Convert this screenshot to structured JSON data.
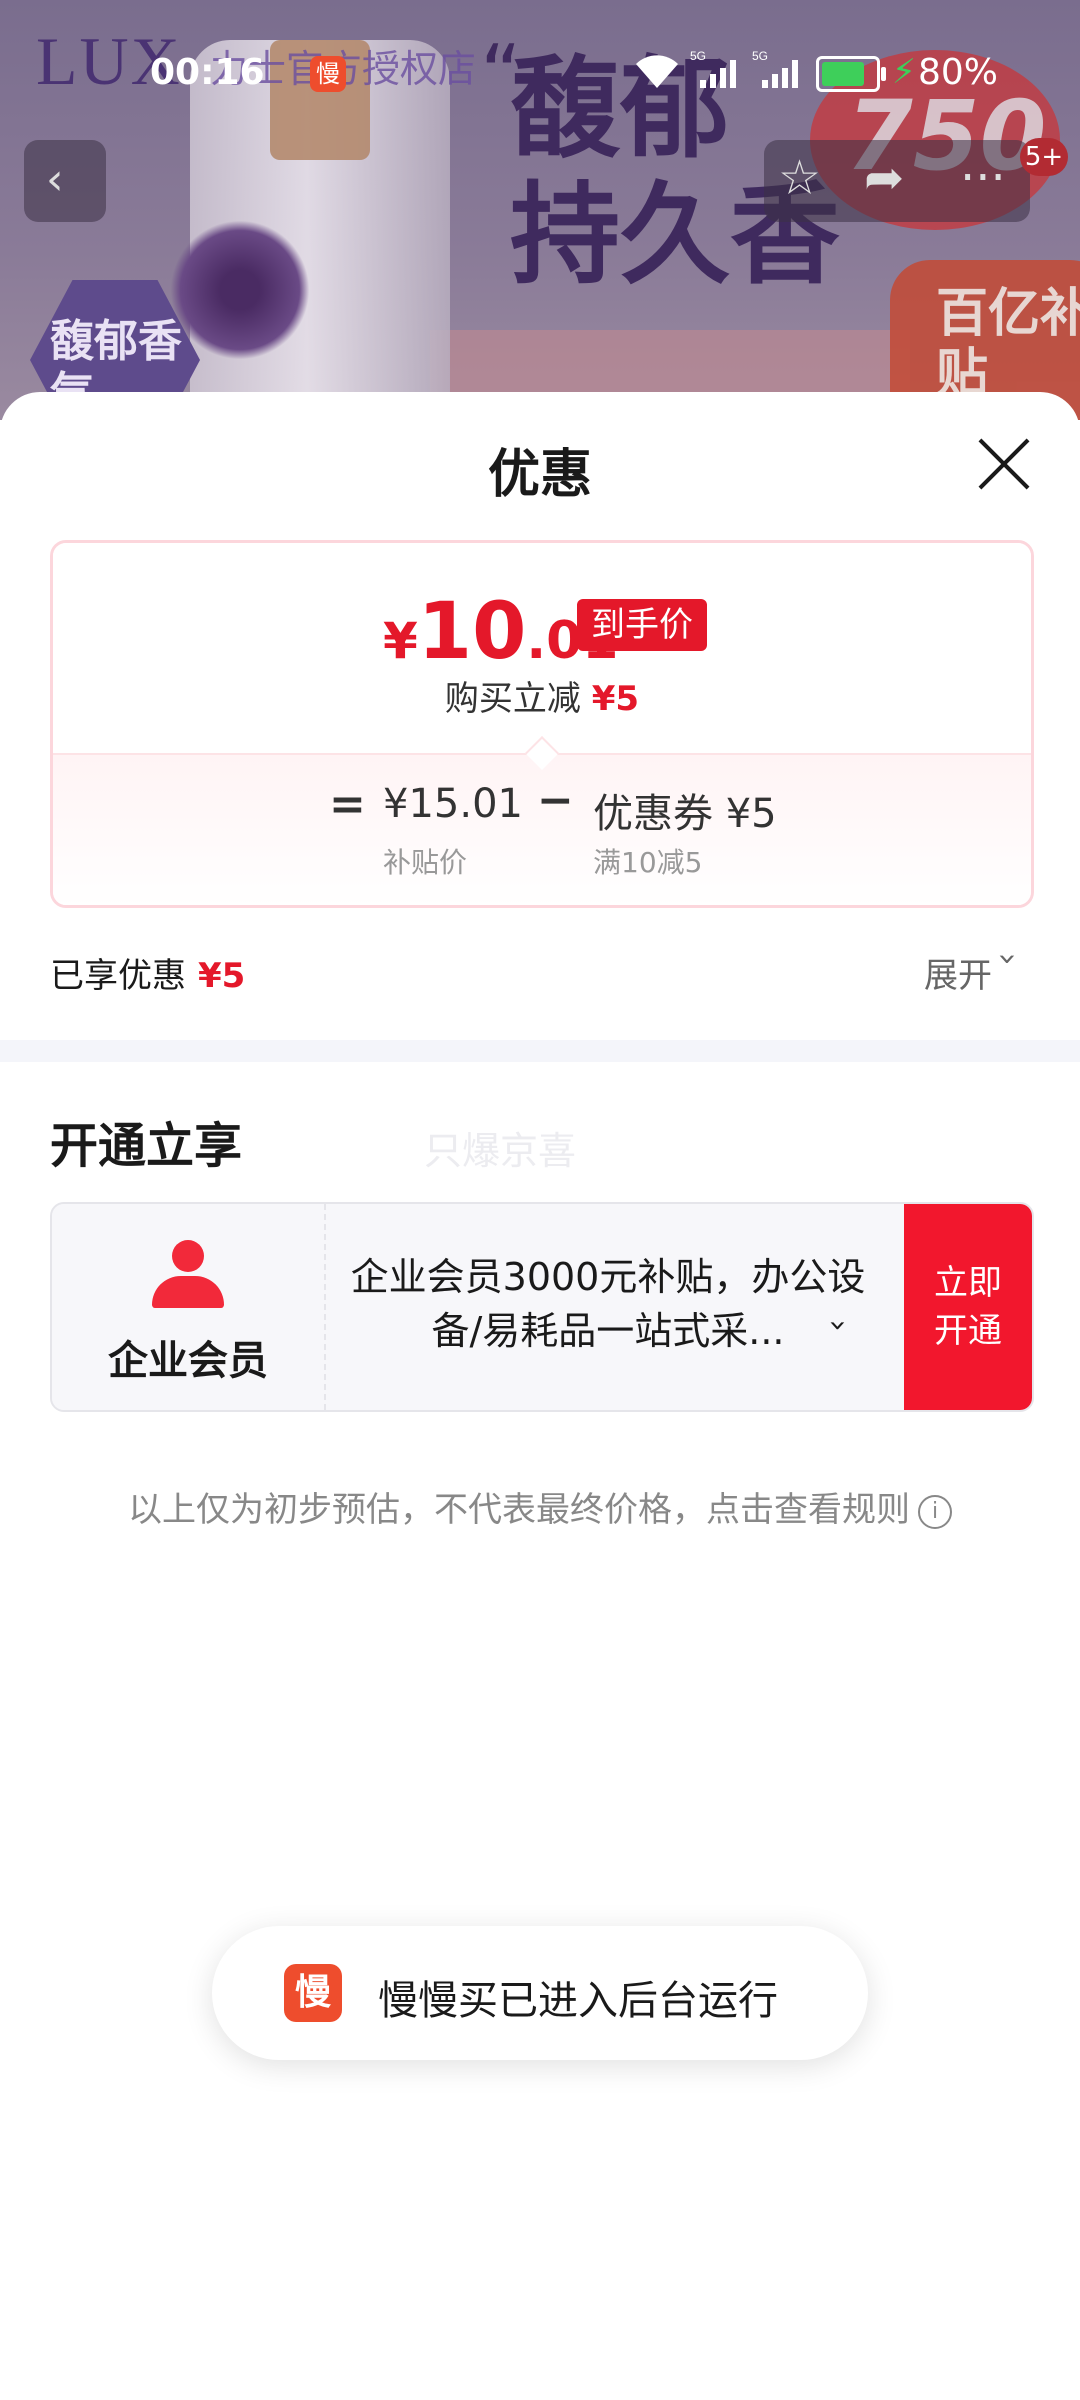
{
  "status_bar": {
    "time": "00:16",
    "app_icon_char": "慢",
    "battery": "80%",
    "battery_level": 0.8
  },
  "banner": {
    "brand_logo": "LUX",
    "store_name": "力士官方授权店",
    "slogan_line1": "馥郁",
    "slogan_line2": "持久香",
    "badge_750": "750",
    "hex_label": "馥郁香气",
    "subsidy_badge": "百亿补贴",
    "cart_count": "5+"
  },
  "sheet": {
    "title": "优惠",
    "price": {
      "yen": "¥",
      "integer": "10",
      "decimal": ".01",
      "final_tag": "到手价",
      "reduce_text": "购买立减",
      "reduce_amount": "¥5"
    },
    "breakdown": {
      "equals": "=",
      "subsidy_price": "¥15.01",
      "subsidy_label": "补贴价",
      "minus": "−",
      "coupon_price": "优惠券 ¥5",
      "coupon_label": "满10减5"
    },
    "enjoyed_label": "已享优惠",
    "enjoyed_amount": "¥5",
    "expand_label": "展开",
    "open_section_title": "开通立享",
    "watermark": "只爆京喜",
    "member": {
      "name": "企业会员",
      "desc": "企业会员3000元补贴，办公设备/易耗品一站式采...",
      "button": "立即开通"
    },
    "disclaimer": "以上仅为初步预估，不代表最终价格，点击查看规则"
  },
  "toast": {
    "icon_char": "慢",
    "text": "慢慢买已进入后台运行"
  },
  "colors": {
    "accent_red": "#e4182a",
    "member_button": "#f2172d",
    "toast_icon": "#ee4d2d"
  }
}
